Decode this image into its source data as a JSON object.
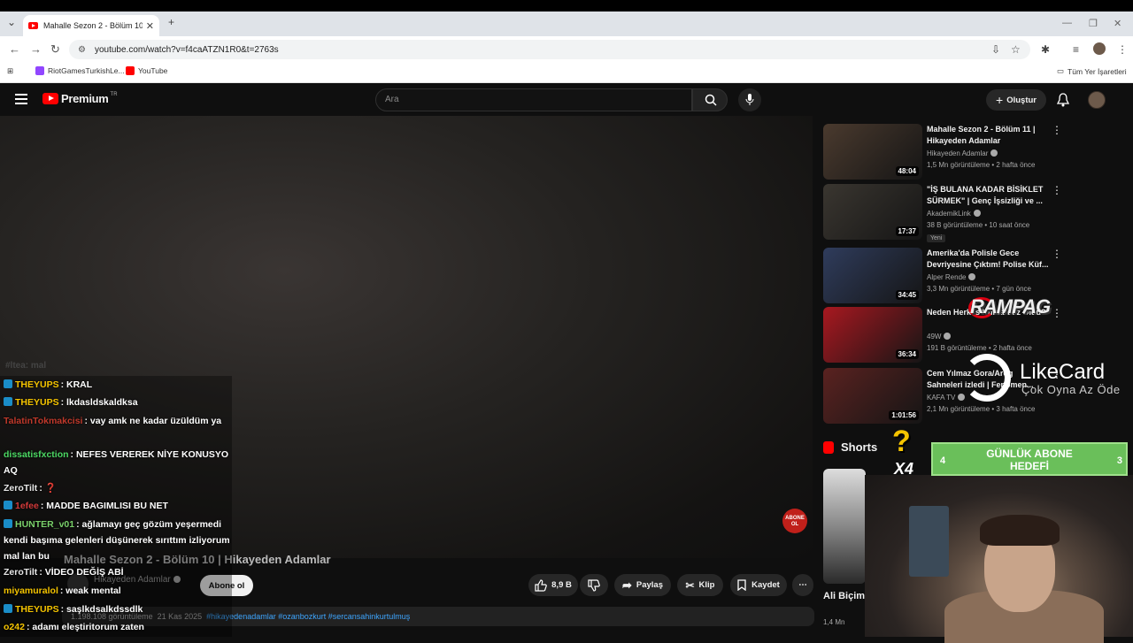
{
  "browser": {
    "tab_title": "Mahalle Sezon 2 - Bölüm 10 | Hi",
    "url": "youtube.com/watch?v=f4caATZN1R0&t=2763s",
    "bookmarks": [
      {
        "label": "RiotGamesTurkishLe..."
      },
      {
        "label": "YouTube"
      }
    ],
    "all_bookmarks": "Tüm Yer İşaretleri"
  },
  "header": {
    "logo_text": "Premium",
    "logo_sup": "TR",
    "search_placeholder": "Ara",
    "create_label": "Oluştur"
  },
  "video": {
    "title": "Mahalle Sezon 2 - Bölüm 10 | Hikayeden Adamlar",
    "channel": "Hikayeden Adamlar",
    "subscribe_label": "Abone ol",
    "likes": "8,9 B",
    "share_label": "Paylaş",
    "clip_label": "Klip",
    "save_label": "Kaydet",
    "views": "1.198.108 görüntüleme",
    "date": "21 Kas 2025",
    "tags": "#hikayedenadamlar #ozanbozkurt #sercansahinkurtulmuş"
  },
  "recommendations": [
    {
      "title": "Mahalle Sezon 2 - Bölüm 11 | Hikayeden Adamlar",
      "channel": "Hikayeden Adamlar",
      "meta": "1,5 Mn görüntüleme • 2 hafta önce",
      "duration": "48:04",
      "thumb_color": "#4a3a2e",
      "badge": ""
    },
    {
      "title": "\"İŞ BULANA KADAR BİSİKLET SÜRMEK\" | Genç İşsizliği ve ...",
      "channel": "AkademikLink",
      "meta": "38 B görüntüleme • 10 saat önce",
      "duration": "17:37",
      "thumb_color": "#3a3630",
      "badge": "Yeni"
    },
    {
      "title": "Amerika'da Polisle Gece Devriyesine Çıktım! Polise Küf...",
      "channel": "Alper Rende",
      "meta": "3,3 Mn görüntüleme • 7 gün önce",
      "duration": "34:45",
      "thumb_color": "#2f3c5c",
      "badge": ""
    },
    {
      "title": "Neden Herkes Kumarbaz Oldu?",
      "channel": "49W",
      "meta": "191 B görüntüleme • 2 hafta önce",
      "duration": "36:34",
      "thumb_color": "#a81820",
      "badge": ""
    },
    {
      "title": "Cem Yılmaz Gora/Arog Sahneleri izledi | Fenomen...",
      "channel": "KAFA TV",
      "meta": "2,1 Mn görüntüleme • 3 hafta önce",
      "duration": "1:01:56",
      "thumb_color": "#5a2220",
      "badge": ""
    }
  ],
  "shorts": {
    "label": "Shorts",
    "item_title": "Ali Biçim'i Oğuzhan B...",
    "item_meta": "1,4 Mn"
  },
  "chat": [
    {
      "user": "THEYUPS",
      "color": "#f5c400",
      "text": ": KRAL",
      "icon": true
    },
    {
      "user": "THEYUPS",
      "color": "#f5c400",
      "text": ": lkdasldskaldksa",
      "icon": true
    },
    {
      "user": "TalatinTokmakcisi",
      "color": "#c0392b",
      "text": ": vay amk ne kadar üzüldüm ya",
      "icon": false
    },
    {
      "user": "dissatisfxction",
      "color": "#4cd964",
      "text": ": NEFES VEREREK NİYE KONUSYO AQ",
      "icon": false
    },
    {
      "user": "ZeroTilt",
      "color": "#e6e6e6",
      "text": ": ❓",
      "icon": false
    },
    {
      "user": "1efee",
      "color": "#d23a3a",
      "text": ": MADDE BAGIMLISI BU NET",
      "icon": true
    },
    {
      "user": "HUNTER_v01",
      "color": "#7ad06a",
      "text": ": ağlamayı geç gözüm yeşermedi kendi başıma gelenleri düşünerek sırıttım izliyorum mal lan bu",
      "icon": true
    },
    {
      "user": "ZeroTilt",
      "color": "#e6e6e6",
      "text": ": VİDEO DEĞİŞ ABİ",
      "icon": false
    },
    {
      "user": "miyamuralol",
      "color": "#f5c400",
      "text": ": weak mental",
      "icon": false
    },
    {
      "user": "THEYUPS",
      "color": "#f5c400",
      "text": ": saşlkdsalkdssdlk",
      "icon": true
    },
    {
      "user": "o242",
      "color": "#f5c400",
      "text": ": adamı eleştiritorum zaten",
      "icon": false
    }
  ],
  "overlays": {
    "rampag": "RAMPAG",
    "likecard": "LikeCard",
    "likecard_sub": "Çok Oyna  Az Öde",
    "goal_title": "GÜNLÜK ABONE HEDEFİ",
    "goal_left": "4",
    "goal_right": "3",
    "multiplier": "X4",
    "abone_ol": "ABONE OL",
    "ghost_text": "#ltea: mal"
  }
}
